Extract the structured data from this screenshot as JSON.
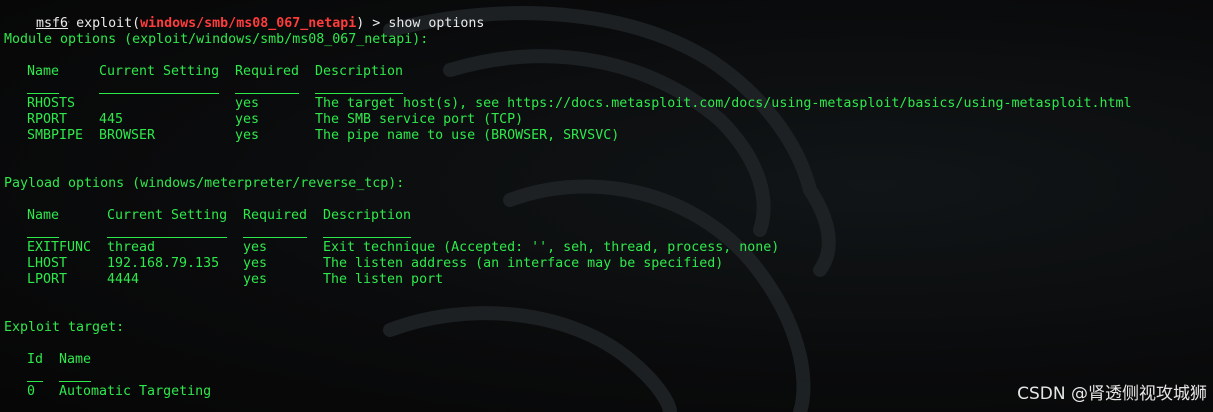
{
  "prompt": {
    "app": "msf6",
    "open": " exploit(",
    "module_path": "windows/smb/ms08_067_netapi",
    "close": ") > ",
    "command": "show options"
  },
  "module_options": {
    "title": "Module options (exploit/windows/smb/ms08_067_netapi):",
    "headers": [
      "Name",
      "Current Setting",
      "Required",
      "Description"
    ],
    "rows": [
      {
        "name": "RHOSTS",
        "setting": "",
        "required": "yes",
        "description": "The target host(s), see https://docs.metasploit.com/docs/using-metasploit/basics/using-metasploit.html"
      },
      {
        "name": "RPORT",
        "setting": "445",
        "required": "yes",
        "description": "The SMB service port (TCP)"
      },
      {
        "name": "SMBPIPE",
        "setting": "BROWSER",
        "required": "yes",
        "description": "The pipe name to use (BROWSER, SRVSVC)"
      }
    ]
  },
  "payload_options": {
    "title": "Payload options (windows/meterpreter/reverse_tcp):",
    "headers": [
      "Name",
      "Current Setting",
      "Required",
      "Description"
    ],
    "rows": [
      {
        "name": "EXITFUNC",
        "setting": "thread",
        "required": "yes",
        "description": "Exit technique (Accepted: '', seh, thread, process, none)"
      },
      {
        "name": "LHOST",
        "setting": "192.168.79.135",
        "required": "yes",
        "description": "The listen address (an interface may be specified)"
      },
      {
        "name": "LPORT",
        "setting": "4444",
        "required": "yes",
        "description": "The listen port"
      }
    ]
  },
  "exploit_target": {
    "title": "Exploit target:",
    "headers": [
      "Id",
      "Name"
    ],
    "rows": [
      {
        "id": "0",
        "name": "Automatic Targeting"
      }
    ]
  },
  "watermark": "CSDN @肾透侧视攻城狮",
  "colors": {
    "background": "#080808",
    "text": "#2fe84c",
    "prompt": "#e9eaea",
    "module": "#ff3b3b"
  }
}
